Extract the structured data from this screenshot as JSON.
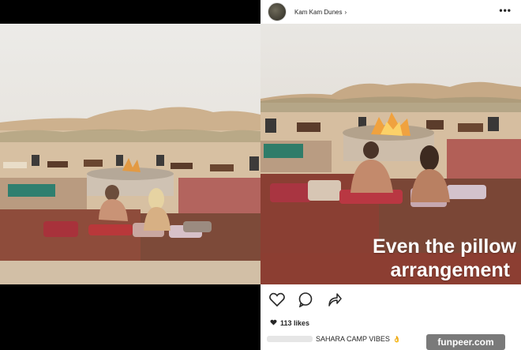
{
  "post": {
    "account_name": "Kam Kam Dunes",
    "more_icon": "more-options-icon",
    "overlay_line1": "Even the pillow",
    "overlay_line2": "arrangement",
    "likes": "113 likes",
    "caption": "SAHARA CAMP VIBES",
    "caption_emoji": "👌"
  },
  "actions": [
    "heart-icon",
    "comment-icon",
    "share-icon"
  ],
  "watermark": "funpeer.com",
  "colors": {
    "sky": "#e6e2dc",
    "sand": "#d9c3a8",
    "rug_red": "#8b3a2e",
    "text_dark": "#262626"
  }
}
